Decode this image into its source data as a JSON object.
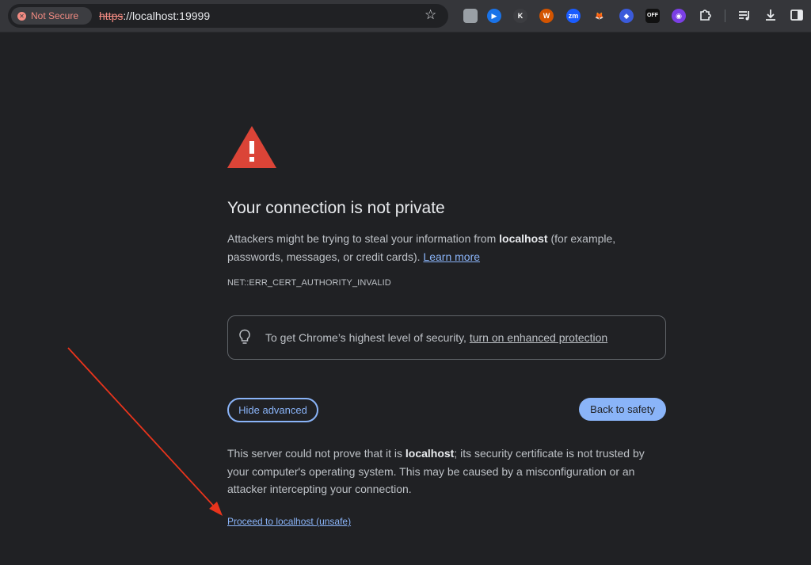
{
  "browser": {
    "security_chip": "Not Secure",
    "url_scheme": "https",
    "url_rest": "://localhost:19999",
    "extensions": [
      {
        "name": "gray-extension-icon",
        "label": "",
        "color": "#9aa0a6"
      },
      {
        "name": "play-extension-icon",
        "label": "▶",
        "color": "#1a73e8"
      },
      {
        "name": "k-extension-icon",
        "label": "K",
        "color": "#3c3d41"
      },
      {
        "name": "wordpress-extension-icon",
        "label": "W",
        "color": "#d35400"
      },
      {
        "name": "zm-extension-icon",
        "label": "zm",
        "color": "#1a5cff"
      },
      {
        "name": "fox-extension-icon",
        "label": "🦊",
        "color": "#35363a"
      },
      {
        "name": "blue-extension-icon",
        "label": "◆",
        "color": "#3b5bdb"
      },
      {
        "name": "dc-off-extension-icon",
        "label": "OFF",
        "color": "#111111"
      },
      {
        "name": "purple-extension-icon",
        "label": "◉",
        "color": "#7b3fe4"
      }
    ]
  },
  "page": {
    "heading": "Your connection is not private",
    "para1_before": "Attackers might be trying to steal your information from ",
    "para1_host": "localhost",
    "para1_after": " (for example, passwords, messages, or credit cards). ",
    "learn_more": "Learn more",
    "error_code": "NET::ERR_CERT_AUTHORITY_INVALID",
    "protection_before": "To get Chrome’s highest level of security, ",
    "protection_link": "turn on enhanced protection",
    "hide_advanced": "Hide advanced",
    "back_to_safety": "Back to safety",
    "para2_before": "This server could not prove that it is ",
    "para2_host": "localhost",
    "para2_after": "; its security certificate is not trusted by your computer's operating system. This may be caused by a misconfiguration or an attacker intercepting your connection.",
    "proceed_link": "Proceed to localhost (unsafe)"
  },
  "colors": {
    "background": "#202124",
    "accent": "#8ab4f8",
    "warning_red": "#db4437",
    "annotation_arrow": "#e8341c"
  }
}
